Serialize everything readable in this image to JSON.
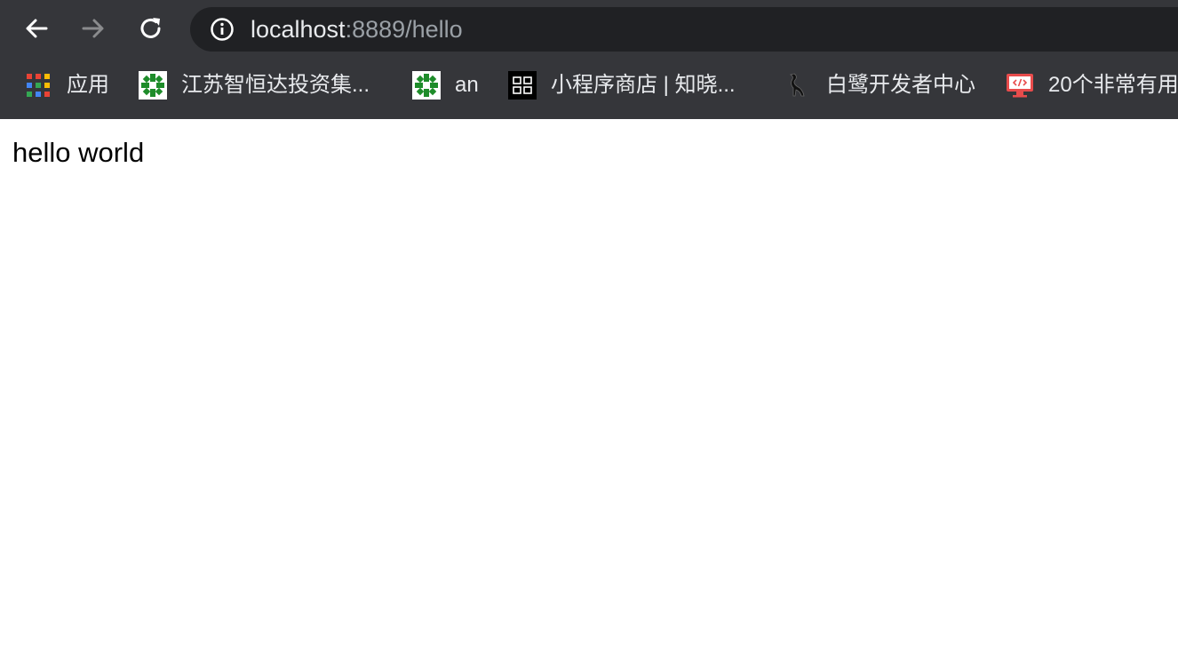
{
  "browser": {
    "nav": {
      "back_icon": "arrow-left-icon",
      "forward_icon": "arrow-right-icon",
      "reload_icon": "reload-icon"
    },
    "address_bar": {
      "host": "localhost",
      "rest": ":8889/hello",
      "security_icon": "info-icon"
    },
    "bookmarks": [
      {
        "label": "应用",
        "icon": "apps-grid-icon"
      },
      {
        "label": "江苏智恒达投资集...",
        "icon": "green-favicon-icon"
      },
      {
        "label": "an",
        "icon": "green-favicon-icon"
      },
      {
        "label": "小程序商店 | 知晓...",
        "icon": "zhixiao-favicon-icon"
      },
      {
        "label": "白鹭开发者中心",
        "icon": "egret-bird-icon"
      },
      {
        "label": "20个非常有用",
        "icon": "code-monitor-icon"
      }
    ]
  },
  "page": {
    "text": "hello world"
  },
  "colors": {
    "chrome": "#35363a",
    "omnibox": "#202124",
    "text_light": "#e8eaed",
    "text_dim": "#9aa0a6",
    "forward_disabled": "#8a8b8d",
    "favicon_green": "#1e8c2a",
    "favicon_red": "#e84c4c"
  }
}
